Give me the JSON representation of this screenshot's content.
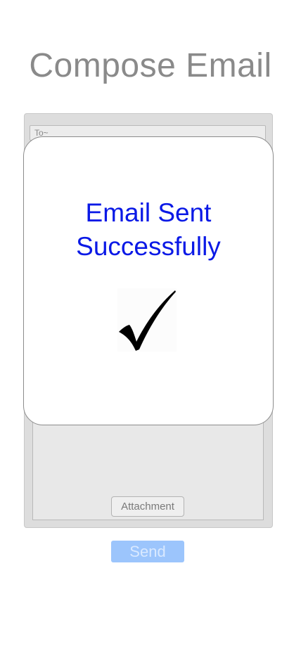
{
  "page": {
    "title": "Compose Email"
  },
  "compose": {
    "to_placeholder": "To~",
    "attachment_label": "Attachment",
    "send_label": "Send"
  },
  "modal": {
    "message_line1": "Email Sent",
    "message_line2": "Successfully",
    "icon": "checkmark-icon"
  },
  "colors": {
    "title_gray": "#8a8a8a",
    "message_blue": "#0a19e6",
    "send_button_disabled": "#9cc5fc"
  }
}
